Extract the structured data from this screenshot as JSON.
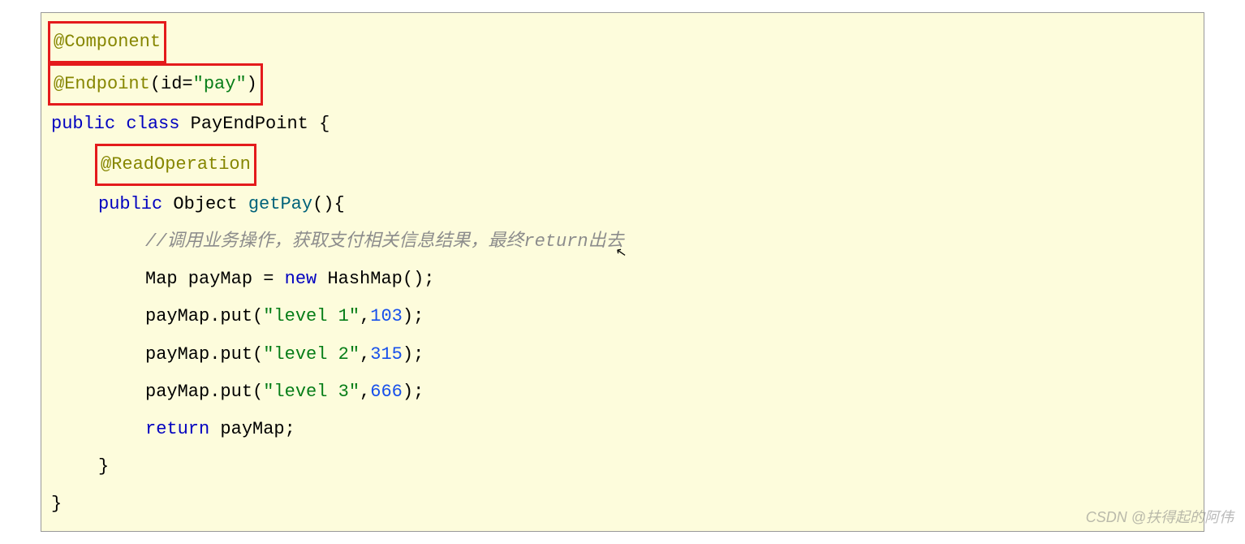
{
  "code": {
    "line1": {
      "annotation": "@Component"
    },
    "line2": {
      "annotation": "@Endpoint",
      "params_open": "(id=",
      "string": "\"pay\"",
      "params_close": ")"
    },
    "line3": {
      "kw1": "public",
      "kw2": "class",
      "plain": " PayEndPoint {"
    },
    "line4": {
      "annotation": "@ReadOperation"
    },
    "line5": {
      "kw": "public",
      "plain1": " Object ",
      "method": "getPay",
      "plain2": "(){"
    },
    "line6": {
      "comment": "//调用业务操作，获取支付相关信息结果，最终return出去"
    },
    "line7": {
      "plain1": "Map payMap = ",
      "kw": "new",
      "plain2": " HashMap();"
    },
    "line8": {
      "plain1": "payMap.put(",
      "str": "\"level 1\"",
      "plain2": ",",
      "num": "103",
      "plain3": ");"
    },
    "line9": {
      "plain1": "payMap.put(",
      "str": "\"level 2\"",
      "plain2": ",",
      "num": "315",
      "plain3": ");"
    },
    "line10": {
      "plain1": "payMap.put(",
      "str": "\"level 3\"",
      "plain2": ",",
      "num": "666",
      "plain3": ");"
    },
    "line11": {
      "kw": "return",
      "plain": " payMap;"
    },
    "line12": {
      "plain": "}"
    },
    "line13": {
      "plain": "}"
    }
  },
  "watermark": "CSDN @扶得起的阿伟",
  "cursor_glyph": "↖"
}
